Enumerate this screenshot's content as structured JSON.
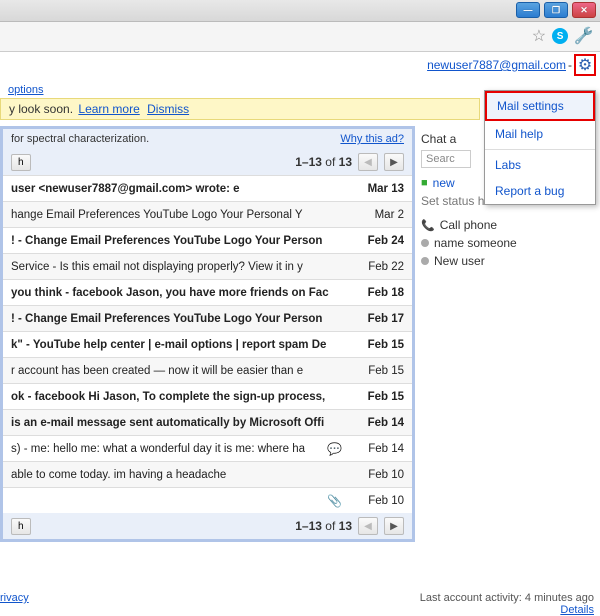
{
  "header": {
    "email": "newuser7887@gmail.com",
    "options_link": "options",
    "yellow_text": "y look soon.",
    "learn_more": "Learn more",
    "dismiss": "Dismiss"
  },
  "ad": {
    "text": "for spectral characterization.",
    "why": "Why this ad?"
  },
  "pager": {
    "left_btn": "h",
    "count_html": "1–13 of 13"
  },
  "dropdown": {
    "mail_settings": "Mail settings",
    "mail_help": "Mail help",
    "labs": "Labs",
    "report_bug": "Report a bug"
  },
  "chat": {
    "title": "Chat a",
    "search_ph": "Searc",
    "new_label": "new",
    "status": "Set status here",
    "call": "Call phone",
    "name": "name someone",
    "user": "New user"
  },
  "messages": [
    {
      "text": "user <newuser7887@gmail.com> wrote: e",
      "date": "Mar 13",
      "unread": true,
      "icon": ""
    },
    {
      "text": "hange Email Preferences YouTube Logo Your Personal Y",
      "date": "Mar 2",
      "unread": false,
      "icon": ""
    },
    {
      "text": "! - Change Email Preferences YouTube Logo Your Person",
      "date": "Feb 24",
      "unread": true,
      "icon": ""
    },
    {
      "text": "Service - Is this email not displaying properly? View it in y",
      "date": "Feb 22",
      "unread": false,
      "icon": ""
    },
    {
      "text": "you think - facebook Jason, you have more friends on Fac",
      "date": "Feb 18",
      "unread": true,
      "icon": ""
    },
    {
      "text": "! - Change Email Preferences YouTube Logo Your Person",
      "date": "Feb 17",
      "unread": true,
      "icon": ""
    },
    {
      "text": "k\" - YouTube help center | e-mail options | report spam De",
      "date": "Feb 15",
      "unread": true,
      "icon": ""
    },
    {
      "text": "r account has been created — now it will be easier than e",
      "date": "Feb 15",
      "unread": false,
      "icon": ""
    },
    {
      "text": "ok - facebook Hi Jason, To complete the sign-up process,",
      "date": "Feb 15",
      "unread": true,
      "icon": ""
    },
    {
      "text": "is an e-mail message sent automatically by Microsoft Offi",
      "date": "Feb 14",
      "unread": true,
      "icon": ""
    },
    {
      "text": "s) - me: hello me: what a wonderful day it is me: where ha",
      "date": "Feb 14",
      "unread": false,
      "icon": "chat"
    },
    {
      "text": "able to come today. im having a headache",
      "date": "Feb 10",
      "unread": false,
      "icon": ""
    },
    {
      "text": "",
      "date": "Feb 10",
      "unread": false,
      "icon": "clip"
    }
  ],
  "footer": {
    "privacy": "rivacy",
    "activity": "Last account activity: 4 minutes ago",
    "details": "Details"
  }
}
